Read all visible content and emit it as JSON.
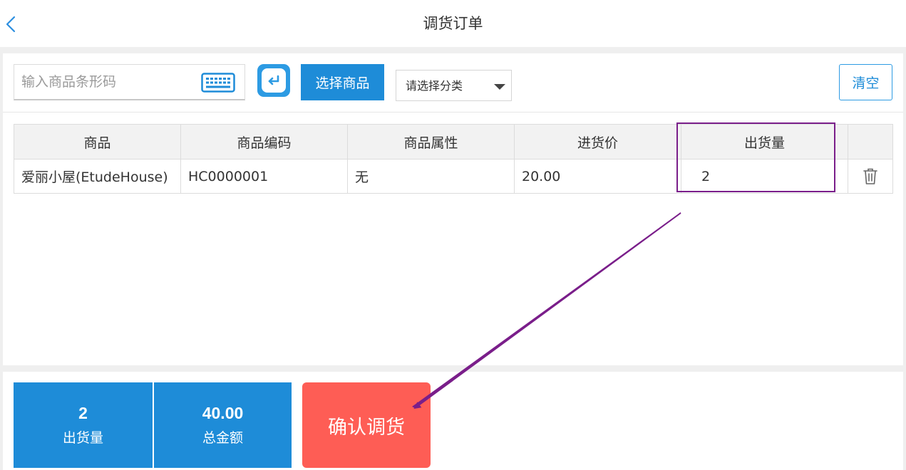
{
  "header": {
    "title": "调货订单"
  },
  "toolbar": {
    "barcode_placeholder": "输入商品条形码",
    "select_goods_label": "选择商品",
    "category_selected": "请选择分类",
    "clear_label": "清空"
  },
  "table": {
    "columns": [
      "商品",
      "商品编码",
      "商品属性",
      "进货价",
      "出货量",
      ""
    ],
    "rows": [
      {
        "name": "爱丽小屋(EtudeHouse)",
        "code": "HC0000001",
        "attr": "无",
        "price": "20.00",
        "qty": "2"
      }
    ]
  },
  "summary": {
    "qty_value": "2",
    "qty_label": "出货量",
    "amount_value": "40.00",
    "amount_label": "总金额"
  },
  "confirm_label": "确认调货",
  "colors": {
    "primary": "#1e8cd8",
    "confirm": "#fe5d55",
    "annotation": "#7a1e8a"
  },
  "icons": [
    "back-chevron-icon",
    "keyboard-icon",
    "enter-icon",
    "dropdown-caret-icon",
    "trash-icon"
  ]
}
